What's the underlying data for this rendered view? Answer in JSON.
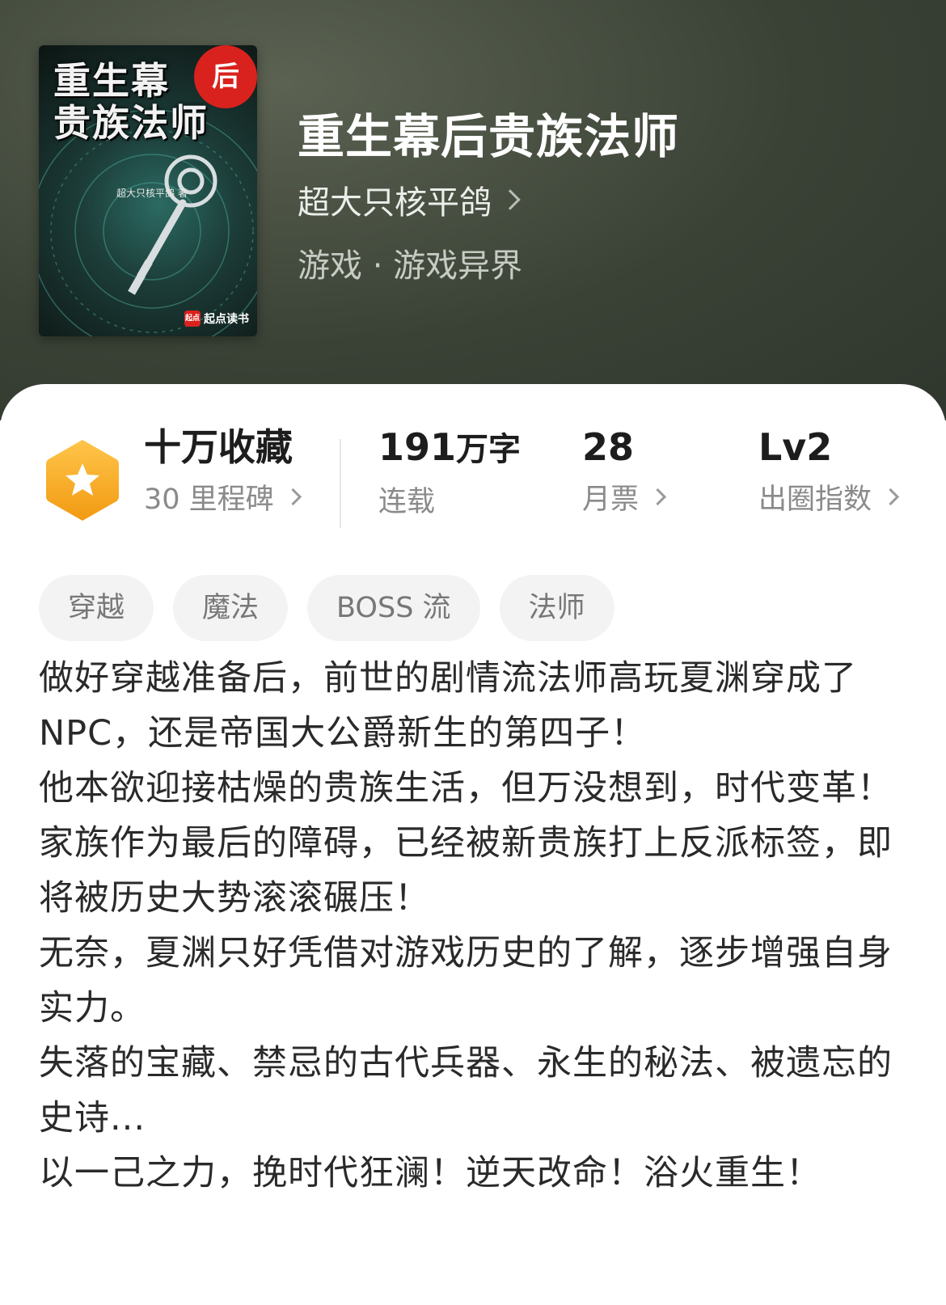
{
  "colors": {
    "header_bg": "#3a4236",
    "card_bg": "#ffffff",
    "badge_orange": "#f5a623",
    "cover_badge_red": "#d9221d"
  },
  "cover": {
    "title_line1": "重生幕",
    "title_line2": "贵族法师",
    "badge": "后",
    "author": "超大只核平鸽 著",
    "publisher_logo": "起点",
    "publisher": "起点读书"
  },
  "book": {
    "title": "重生幕后贵族法师",
    "author": "超大只核平鸽",
    "genre": "游戏 · 游戏异界"
  },
  "stats": {
    "favorites": {
      "value": "十万收藏",
      "label": "30 里程碑",
      "icon": "star-hexagon-icon"
    },
    "words": {
      "value": "191",
      "unit": "万字",
      "label": "连载"
    },
    "tickets": {
      "value": "28",
      "label": "月票"
    },
    "level": {
      "value": "Lv2",
      "label": "出圈指数"
    }
  },
  "tags": [
    "穿越",
    "魔法",
    "BOSS 流",
    "法师"
  ],
  "synopsis": [
    "做好穿越准备后，前世的剧情流法师高玩夏渊穿成了NPC，还是帝国大公爵新生的第四子！",
    "他本欲迎接枯燥的贵族生活，但万没想到，时代变革！",
    "家族作为最后的障碍，已经被新贵族打上反派标签，即将被历史大势滚滚碾压！",
    "无奈，夏渊只好凭借对游戏历史的了解，逐步增强自身实力。",
    "失落的宝藏、禁忌的古代兵器、永生的秘法、被遗忘的史诗...",
    "以一己之力，挽时代狂澜！逆天改命！浴火重生！"
  ]
}
